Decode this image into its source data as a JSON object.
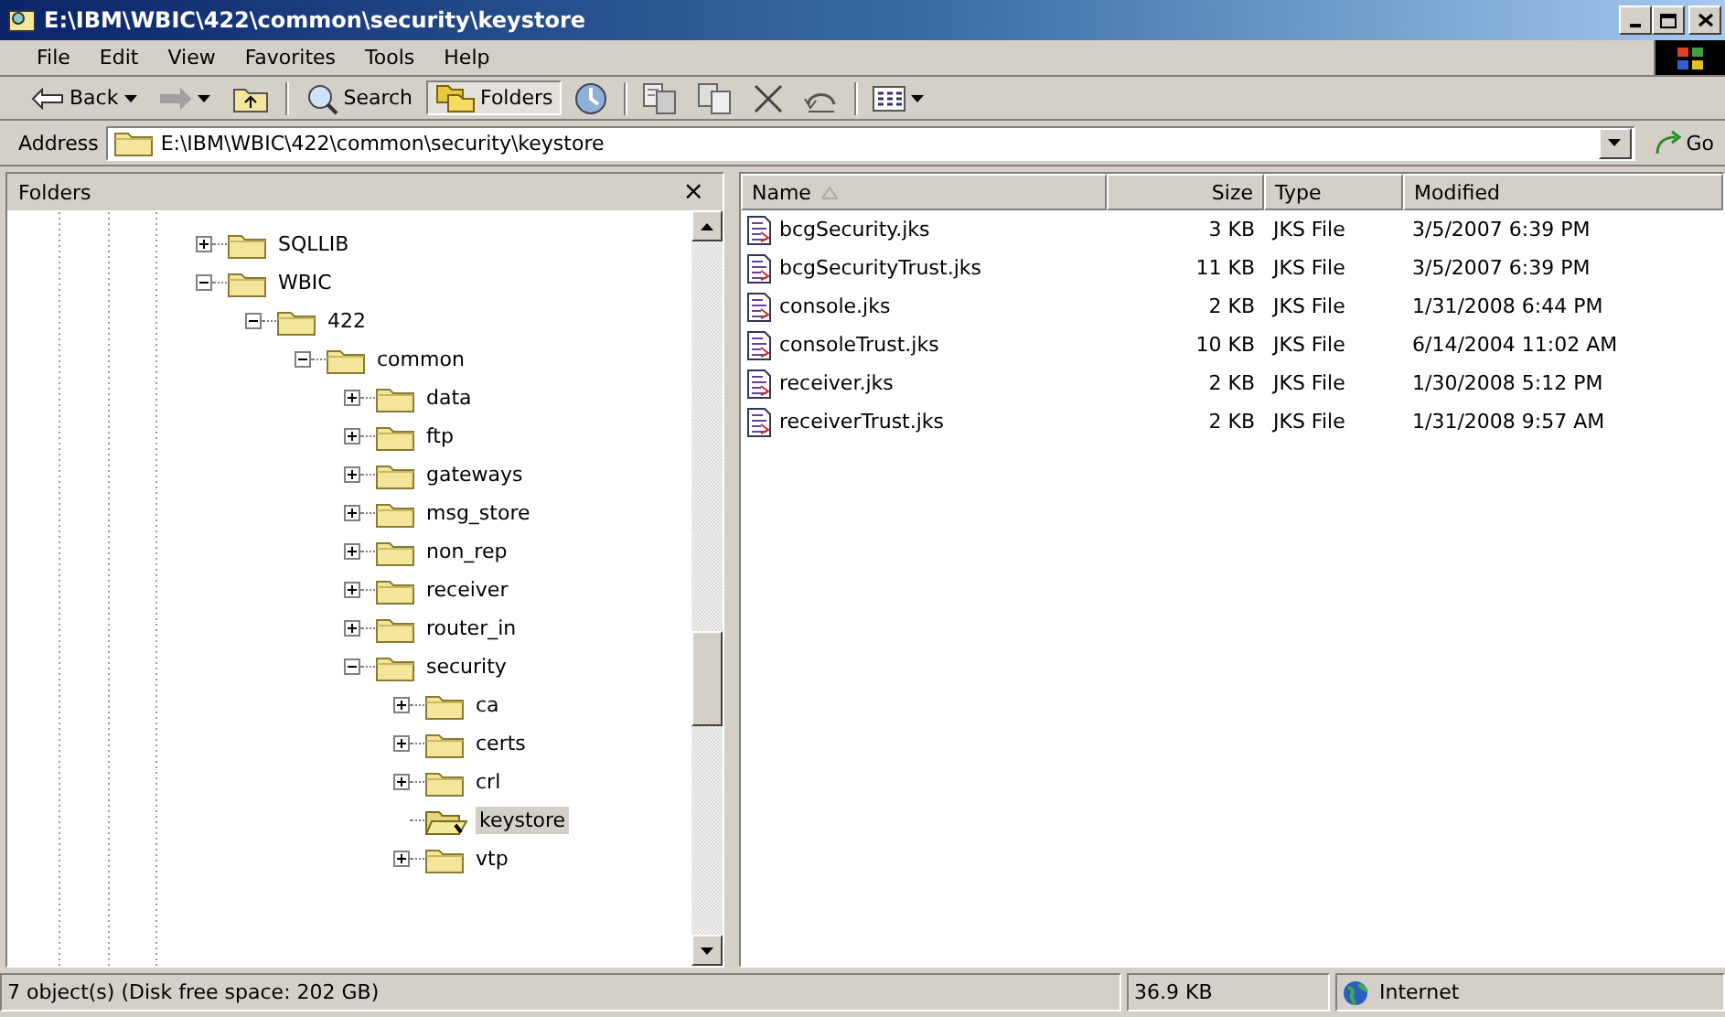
{
  "window": {
    "title": "E:\\IBM\\WBIC\\422\\common\\security\\keystore"
  },
  "menu": [
    "File",
    "Edit",
    "View",
    "Favorites",
    "Tools",
    "Help"
  ],
  "toolbar": [
    {
      "kind": "back",
      "label": "Back",
      "disabled": false,
      "selected": false
    },
    {
      "kind": "forward",
      "disabled": true,
      "selected": false
    },
    {
      "kind": "up",
      "selected": false
    },
    {
      "kind": "search",
      "label": "Search",
      "selected": false
    },
    {
      "kind": "folders",
      "label": "Folders",
      "selected": true
    },
    {
      "kind": "history",
      "selected": false
    },
    {
      "kind": "move",
      "selected": false
    },
    {
      "kind": "copy",
      "selected": false
    },
    {
      "kind": "delete",
      "selected": false
    },
    {
      "kind": "undo",
      "selected": false
    },
    {
      "kind": "views",
      "selected": false
    }
  ],
  "address": {
    "label": "Address",
    "value": "E:\\IBM\\WBIC\\422\\common\\security\\keystore",
    "go": "Go"
  },
  "folders": {
    "title": "Folders",
    "close": "×",
    "items": [
      {
        "name": "SQLLIB",
        "expandable": true,
        "expanded": false,
        "selected": false
      },
      {
        "name": "WBIC",
        "expandable": true,
        "expanded": true,
        "selected": false,
        "children": [
          {
            "name": "422",
            "expandable": true,
            "expanded": true,
            "selected": false,
            "children": [
              {
                "name": "common",
                "expandable": true,
                "expanded": true,
                "selected": false,
                "children": [
                  {
                    "name": "data",
                    "expandable": true,
                    "expanded": false,
                    "selected": false
                  },
                  {
                    "name": "ftp",
                    "expandable": true,
                    "expanded": false,
                    "selected": false
                  },
                  {
                    "name": "gateways",
                    "expandable": true,
                    "expanded": false,
                    "selected": false
                  },
                  {
                    "name": "msg_store",
                    "expandable": true,
                    "expanded": false,
                    "selected": false
                  },
                  {
                    "name": "non_rep",
                    "expandable": true,
                    "expanded": false,
                    "selected": false
                  },
                  {
                    "name": "receiver",
                    "expandable": true,
                    "expanded": false,
                    "selected": false
                  },
                  {
                    "name": "router_in",
                    "expandable": true,
                    "expanded": false,
                    "selected": false
                  },
                  {
                    "name": "security",
                    "expandable": true,
                    "expanded": true,
                    "selected": false,
                    "children": [
                      {
                        "name": "ca",
                        "expandable": true,
                        "expanded": false,
                        "selected": false
                      },
                      {
                        "name": "certs",
                        "expandable": true,
                        "expanded": false,
                        "selected": false
                      },
                      {
                        "name": "crl",
                        "expandable": true,
                        "expanded": false,
                        "selected": false
                      },
                      {
                        "name": "keystore",
                        "expandable": false,
                        "selected": true
                      },
                      {
                        "name": "vtp",
                        "expandable": true,
                        "expanded": false,
                        "selected": false
                      }
                    ]
                  }
                ]
              }
            ]
          }
        ]
      }
    ]
  },
  "files": {
    "columns": [
      {
        "label": "Name",
        "sorted": true
      },
      {
        "label": "Size",
        "sorted": false
      },
      {
        "label": "Type",
        "sorted": false
      },
      {
        "label": "Modified",
        "sorted": false
      }
    ],
    "rows": [
      {
        "name": "bcgSecurity.jks",
        "size": "3 KB",
        "type": "JKS File",
        "modified": "3/5/2007 6:39 PM"
      },
      {
        "name": "bcgSecurityTrust.jks",
        "size": "11 KB",
        "type": "JKS File",
        "modified": "3/5/2007 6:39 PM"
      },
      {
        "name": "console.jks",
        "size": "2 KB",
        "type": "JKS File",
        "modified": "1/31/2008 6:44 PM"
      },
      {
        "name": "consoleTrust.jks",
        "size": "10 KB",
        "type": "JKS File",
        "modified": "6/14/2004 11:02 AM"
      },
      {
        "name": "receiver.jks",
        "size": "2 KB",
        "type": "JKS File",
        "modified": "1/30/2008 5:12 PM"
      },
      {
        "name": "receiverTrust.jks",
        "size": "2 KB",
        "type": "JKS File",
        "modified": "1/31/2008 9:57 AM"
      }
    ]
  },
  "status_bar": {
    "text": "7 object(s) (Disk free space: 202 GB)",
    "size": "36.9 KB",
    "zone": "Internet"
  }
}
